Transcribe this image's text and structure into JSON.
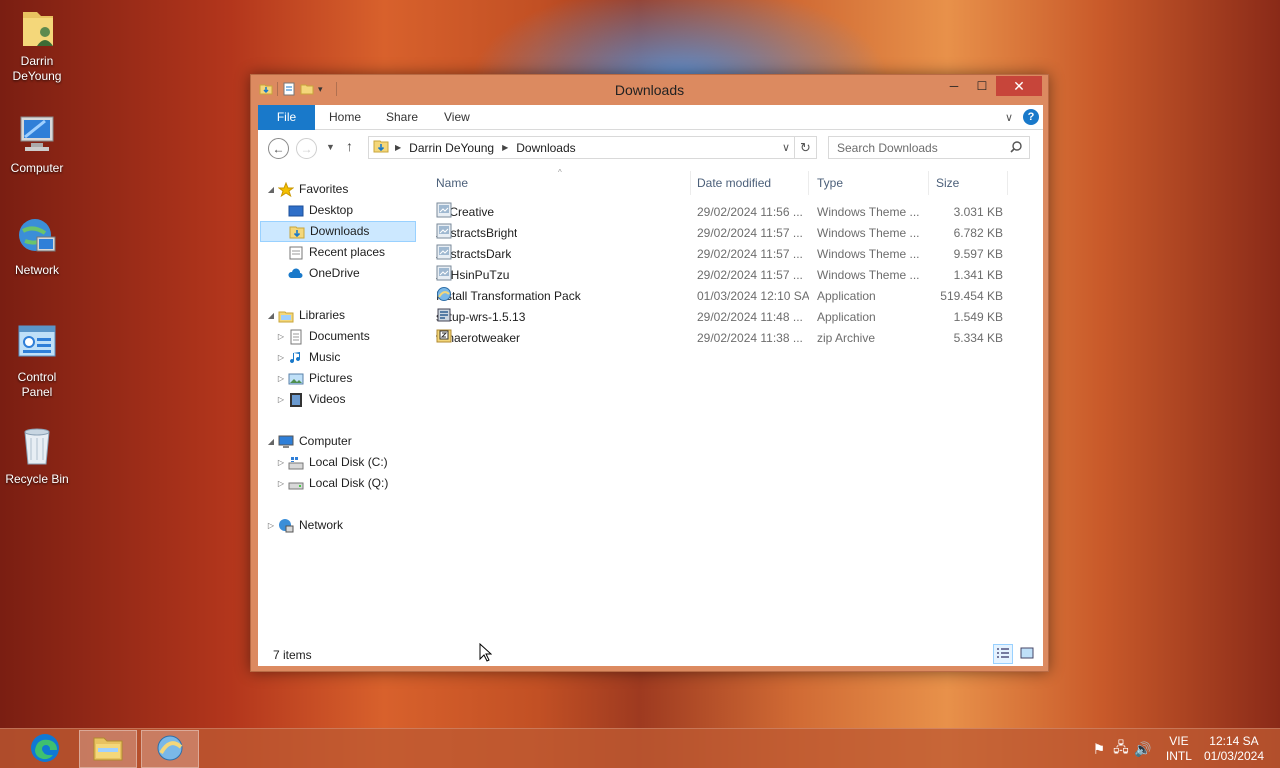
{
  "desktop": {
    "icons": [
      {
        "label": "Darrin\nDeYoung",
        "icon": "user-folder-icon"
      },
      {
        "label": "Computer",
        "icon": "computer-icon"
      },
      {
        "label": "Network",
        "icon": "network-icon"
      },
      {
        "label": "Control Panel",
        "icon": "control-panel-icon"
      },
      {
        "label": "Recycle Bin",
        "icon": "recycle-bin-icon"
      }
    ]
  },
  "window": {
    "title": "Downloads",
    "controls": {
      "minimize": "─",
      "maximize": "☐",
      "close": "✕"
    },
    "ribbon": {
      "tabs": [
        "File",
        "Home",
        "Share",
        "View"
      ],
      "help": "?"
    },
    "nav": {
      "breadcrumb": [
        "Darrin DeYoung",
        "Downloads"
      ],
      "search_placeholder": "Search Downloads"
    },
    "tree": {
      "favorites": {
        "label": "Favorites",
        "items": [
          "Desktop",
          "Downloads",
          "Recent places",
          "OneDrive"
        ]
      },
      "libraries": {
        "label": "Libraries",
        "items": [
          "Documents",
          "Music",
          "Pictures",
          "Videos"
        ]
      },
      "computer": {
        "label": "Computer",
        "items": [
          "Local Disk (C:)",
          "Local Disk (Q:)"
        ]
      },
      "network": {
        "label": "Network"
      }
    },
    "columns": [
      "Name",
      "Date modified",
      "Type",
      "Size"
    ],
    "files": [
      {
        "name": "26Creative",
        "date": "29/02/2024 11:56 ...",
        "type": "Windows Theme ...",
        "size": "3.031 KB",
        "icon": "theme-pack-icon"
      },
      {
        "name": "AbstractsBright",
        "date": "29/02/2024 11:57 ...",
        "type": "Windows Theme ...",
        "size": "6.782 KB",
        "icon": "theme-pack-icon"
      },
      {
        "name": "AbstractsDark",
        "date": "29/02/2024 11:57 ...",
        "type": "Windows Theme ...",
        "size": "9.597 KB",
        "icon": "theme-pack-icon"
      },
      {
        "name": "AnHsinPuTzu",
        "date": "29/02/2024 11:57 ...",
        "type": "Windows Theme ...",
        "size": "1.341 KB",
        "icon": "theme-pack-icon"
      },
      {
        "name": "Install Transformation Pack",
        "date": "01/03/2024 12:10 SA",
        "type": "Application",
        "size": "519.454 KB",
        "icon": "installer-icon"
      },
      {
        "name": "setup-wrs-1.5.13",
        "date": "29/02/2024 11:48 ...",
        "type": "Application",
        "size": "1.549 KB",
        "icon": "setup-icon"
      },
      {
        "name": "winaerotweaker",
        "date": "29/02/2024 11:38 ...",
        "type": "zip Archive",
        "size": "5.334 KB",
        "icon": "zip-icon"
      }
    ],
    "status": {
      "item_count": "7 items"
    }
  },
  "taskbar": {
    "tray": {
      "lang_line1": "VIE",
      "lang_line2": "INTL",
      "time": "12:14 SA",
      "date": "01/03/2024"
    }
  },
  "colors": {
    "accent": "#1979ca",
    "titlebar": "#dc8a60",
    "selection": "#cce8ff",
    "close": "#c7453a"
  }
}
